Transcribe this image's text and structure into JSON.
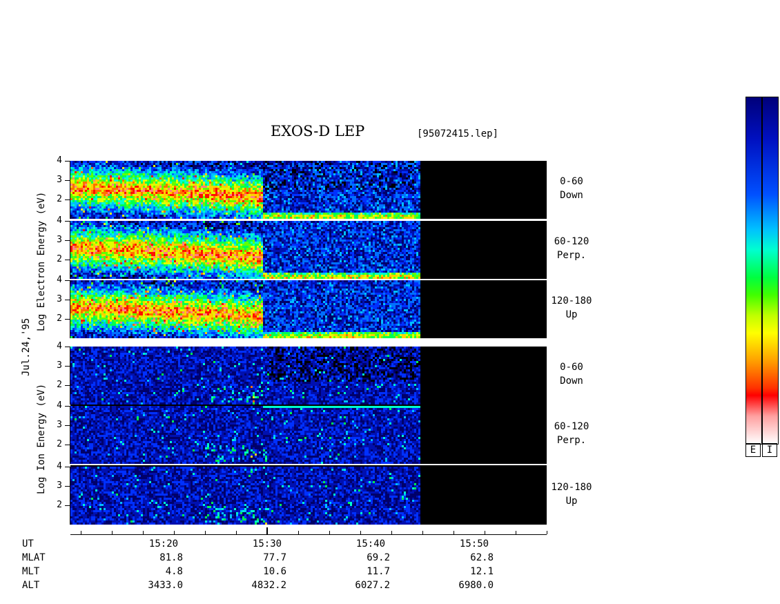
{
  "header": {
    "title": "EXOS-D LEP",
    "file": "[95072415.lep]"
  },
  "date_label": "Jul.24,'95",
  "electron_ylabel": "Log  Electron  Energy (eV)",
  "ion_ylabel": "Log  Ion  Energy (eV)",
  "ytick_labels": [
    "4",
    "3",
    "2"
  ],
  "pitch_labels": [
    {
      "range": "0-60",
      "dir": "Down"
    },
    {
      "range": "60-120",
      "dir": "Perp."
    },
    {
      "range": "120-180",
      "dir": "Up"
    }
  ],
  "colorbar": {
    "e_label": "E",
    "i_label": "I"
  },
  "time_axis": {
    "ticks": [
      "15:20",
      "15:30",
      "15:40",
      "15:50"
    ]
  },
  "ephemeris": {
    "row_labels": [
      "UT",
      "MLAT",
      "MLT",
      "ALT"
    ],
    "MLAT": [
      "81.8",
      "77.7",
      "69.2",
      "62.8"
    ],
    "MLT": [
      "4.8",
      "10.6",
      "11.7",
      "12.1"
    ],
    "ALT": [
      "3433.0",
      "4832.2",
      "6027.2",
      "6980.0"
    ]
  },
  "chart_data": {
    "type": "heatmap",
    "title": "EXOS-D LEP",
    "x_range": [
      "15:11",
      "15:57"
    ],
    "data_end_time": "15:44.8",
    "y_range": [
      1,
      4
    ],
    "panels": [
      {
        "species": "Electron",
        "pitch": "0-60 Down"
      },
      {
        "species": "Electron",
        "pitch": "60-120 Perp."
      },
      {
        "species": "Electron",
        "pitch": "120-180 Up"
      },
      {
        "species": "Ion",
        "pitch": "0-60 Down"
      },
      {
        "species": "Ion",
        "pitch": "60-120 Perp."
      },
      {
        "species": "Ion",
        "pitch": "120-180 Up"
      }
    ]
  }
}
